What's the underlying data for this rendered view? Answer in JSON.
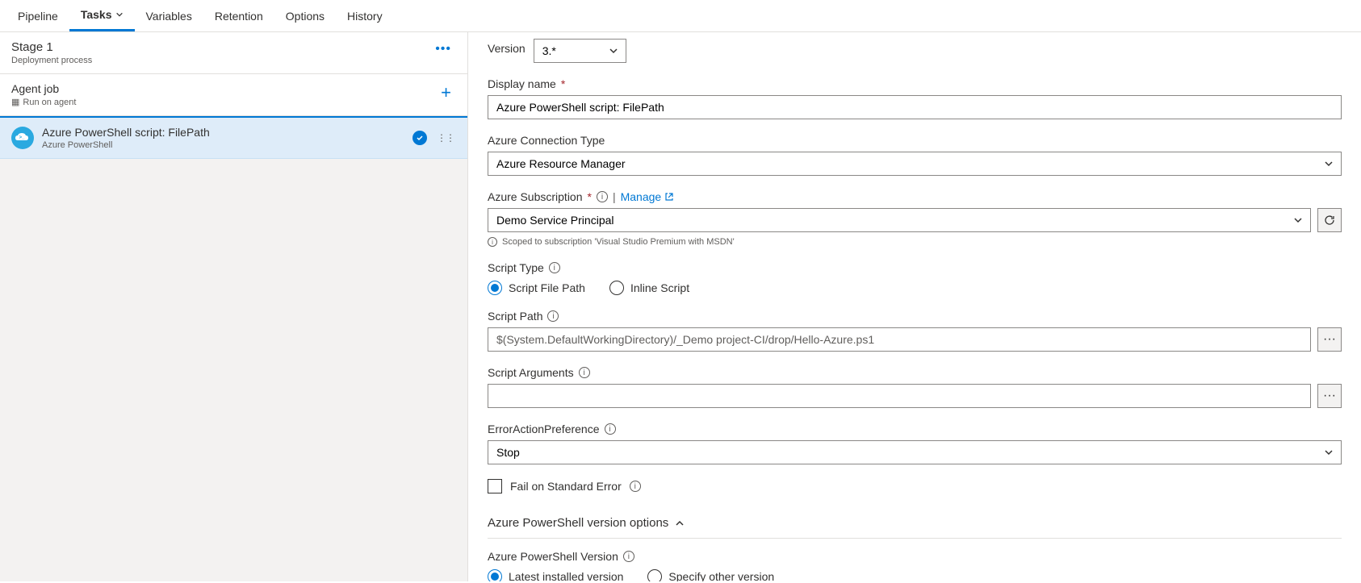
{
  "nav": {
    "tabs": [
      "Pipeline",
      "Tasks",
      "Variables",
      "Retention",
      "Options",
      "History"
    ],
    "active": "Tasks"
  },
  "left": {
    "stage": {
      "title": "Stage 1",
      "subtitle": "Deployment process"
    },
    "agent": {
      "title": "Agent job",
      "subtitle": "Run on agent"
    },
    "task": {
      "title": "Azure PowerShell script: FilePath",
      "subtitle": "Azure PowerShell"
    }
  },
  "form": {
    "version_label": "Version",
    "version_value": "3.*",
    "display_name_label": "Display name",
    "display_name_value": "Azure PowerShell script: FilePath",
    "conn_type_label": "Azure Connection Type",
    "conn_type_value": "Azure Resource Manager",
    "subscription_label": "Azure Subscription",
    "subscription_value": "Demo Service Principal",
    "manage_label": "Manage",
    "scope_note": "Scoped to subscription 'Visual Studio Premium with MSDN'",
    "script_type_label": "Script Type",
    "script_type_options": [
      "Script File Path",
      "Inline Script"
    ],
    "script_path_label": "Script Path",
    "script_path_value": "$(System.DefaultWorkingDirectory)/_Demo project-CI/drop/Hello-Azure.ps1",
    "script_args_label": "Script Arguments",
    "script_args_value": "",
    "error_pref_label": "ErrorActionPreference",
    "error_pref_value": "Stop",
    "fail_stderr_label": "Fail on Standard Error",
    "section_title": "Azure PowerShell version options",
    "ps_version_label": "Azure PowerShell Version",
    "ps_version_options": [
      "Latest installed version",
      "Specify other version"
    ]
  }
}
